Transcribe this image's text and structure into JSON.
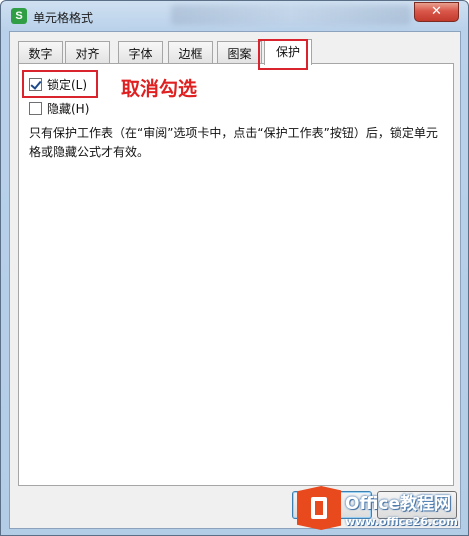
{
  "window": {
    "title": "单元格格式",
    "app_icon_glyph": "S",
    "close_glyph": "✕"
  },
  "tabs": [
    {
      "label": "数字",
      "active": false
    },
    {
      "label": "对齐",
      "active": false
    },
    {
      "label": "字体",
      "active": false
    },
    {
      "label": "边框",
      "active": false
    },
    {
      "label": "图案",
      "active": false
    },
    {
      "label": "保护",
      "active": true
    }
  ],
  "protection": {
    "locked": {
      "label": "锁定(L)",
      "checked": true
    },
    "hidden": {
      "label": "隐藏(H)",
      "checked": false
    },
    "description": "只有保护工作表（在“审阅”选项卡中，点击“保护工作表”按钮）后，锁定单元格或隐藏公式才有效。"
  },
  "annotation": {
    "text": "取消勾选",
    "color": "#e02020"
  },
  "buttons": {
    "ok_label": "",
    "cancel_label": ""
  },
  "watermark": {
    "title": "Office教程网",
    "url": "www.office26.com",
    "logo_color": "#e8491d"
  },
  "colors": {
    "highlight_box": "#d9232d",
    "app_icon": "#2f9e44",
    "close_button": "#c9463a"
  }
}
